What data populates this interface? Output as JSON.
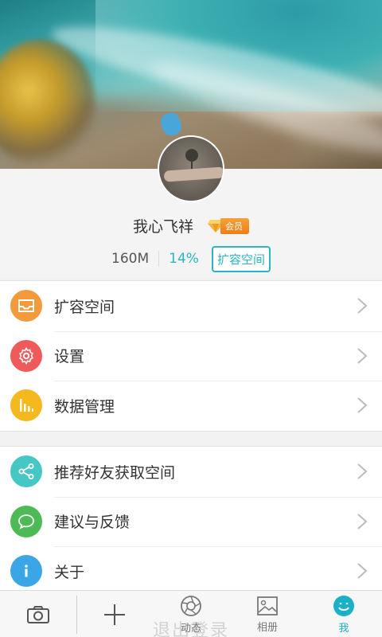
{
  "profile": {
    "username": "我心飞祥",
    "vip_label": "会员",
    "storage_used": "160M",
    "storage_percent": "14%",
    "expand_label": "扩容空间"
  },
  "menu_group_1": [
    {
      "label": "扩容空间",
      "icon": "tray-icon",
      "color": "#f39a3d"
    },
    {
      "label": "设置",
      "icon": "gear-icon",
      "color": "#ef5a5a"
    },
    {
      "label": "数据管理",
      "icon": "bar-chart-icon",
      "color": "#f5b81f"
    }
  ],
  "menu_group_2": [
    {
      "label": "推荐好友获取空间",
      "icon": "share-icon",
      "color": "#46c7c4"
    },
    {
      "label": "建议与反馈",
      "icon": "chat-bubble-icon",
      "color": "#4cbb55"
    },
    {
      "label": "关于",
      "icon": "info-icon",
      "color": "#3ba6e6"
    }
  ],
  "logout_label": "退出登录",
  "tabbar": {
    "camera": {
      "icon": "camera-icon"
    },
    "add": {
      "icon": "plus-icon"
    },
    "feed": {
      "label": "动态",
      "icon": "aperture-icon"
    },
    "album": {
      "label": "相册",
      "icon": "photo-icon"
    },
    "me": {
      "label": "我",
      "icon": "user-face-icon",
      "active_color": "#1ab0c8"
    }
  }
}
